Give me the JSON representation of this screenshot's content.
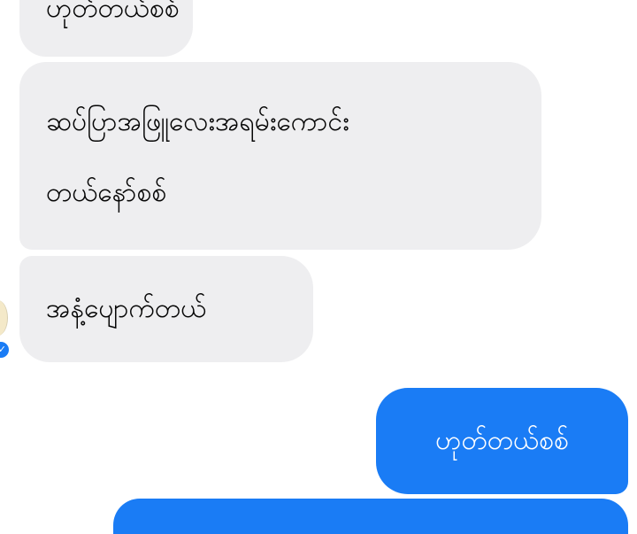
{
  "messages": [
    {
      "from": "other",
      "lines": [
        "ဟုတ်တယ်စစ်"
      ]
    },
    {
      "from": "other",
      "lines": [
        "ဆပ်ပြာအဖြူလေးအရမ်းကောင်း",
        "တယ်နော်စစ်"
      ]
    },
    {
      "from": "other",
      "lines": [
        "အနံ့ပျောက်တယ်"
      ]
    },
    {
      "from": "me",
      "lines": [
        "ဟုတ်တယ်စစ်"
      ]
    }
  ],
  "icons": {
    "avatar": "avatar-icon",
    "seen": "seen-check-icon"
  },
  "colors": {
    "incoming_bubble": "#eeeef0",
    "outgoing_bubble": "#1a7cf5",
    "background": "#ffffff"
  }
}
